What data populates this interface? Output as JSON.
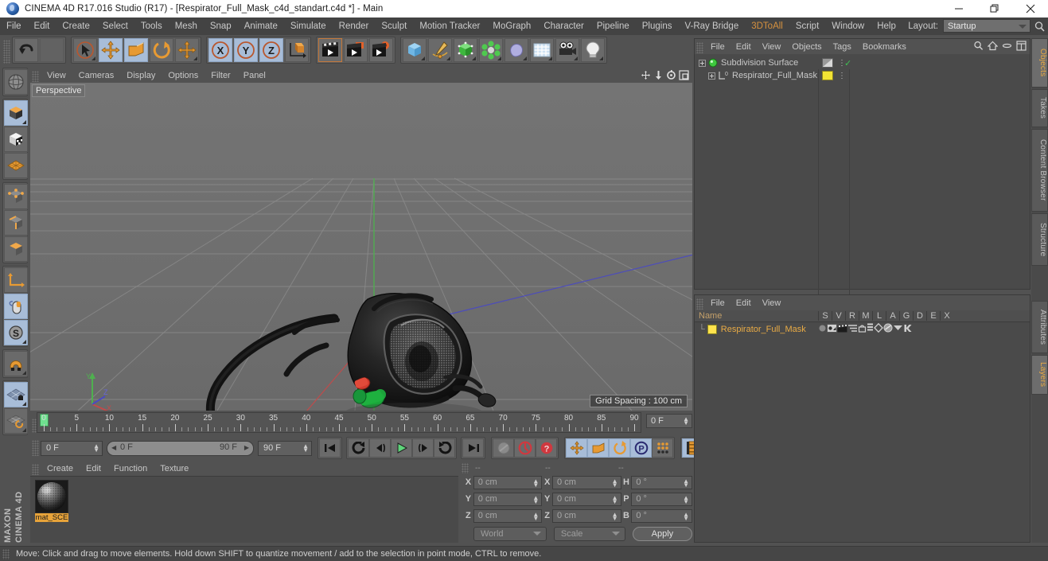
{
  "window": {
    "title": "CINEMA 4D R17.016 Studio (R17) - [Respirator_Full_Mask_c4d_standart.c4d *] - Main",
    "app_icon": "c4d-logo-icon",
    "minimize": "minimize-icon",
    "maximize": "maximize-icon",
    "close": "close-icon"
  },
  "menubar": {
    "items": [
      {
        "label": "File"
      },
      {
        "label": "Edit"
      },
      {
        "label": "Create"
      },
      {
        "label": "Select"
      },
      {
        "label": "Tools"
      },
      {
        "label": "Mesh"
      },
      {
        "label": "Snap"
      },
      {
        "label": "Animate"
      },
      {
        "label": "Simulate"
      },
      {
        "label": "Render"
      },
      {
        "label": "Sculpt"
      },
      {
        "label": "Motion Tracker"
      },
      {
        "label": "MoGraph"
      },
      {
        "label": "Character"
      },
      {
        "label": "Pipeline"
      },
      {
        "label": "Plugins"
      },
      {
        "label": "V-Ray Bridge"
      },
      {
        "label": "3DToAll",
        "accent": true
      },
      {
        "label": "Script"
      },
      {
        "label": "Window"
      },
      {
        "label": "Help"
      }
    ],
    "layout_label": "Layout:",
    "layout_value": "Startup",
    "search_icon": "search-icon"
  },
  "main_toolbar": {
    "groups": [
      {
        "name": "history",
        "buttons": [
          {
            "icon": "undo-icon",
            "state": "enabled"
          },
          {
            "icon": "redo-icon",
            "state": "disabled"
          }
        ]
      },
      {
        "name": "tools",
        "buttons": [
          {
            "icon": "select-live-icon",
            "state": "enabled"
          },
          {
            "icon": "move-tool-icon",
            "state": "active"
          },
          {
            "icon": "scale-tool-icon",
            "state": "enabled"
          },
          {
            "icon": "rotate-tool-icon",
            "state": "enabled"
          },
          {
            "icon": "move-axis-icon",
            "state": "enabled"
          }
        ]
      },
      {
        "name": "axis-locks",
        "buttons": [
          {
            "icon": "axis-x-icon",
            "state": "active"
          },
          {
            "icon": "axis-y-icon",
            "state": "active"
          },
          {
            "icon": "axis-z-icon",
            "state": "active"
          },
          {
            "icon": "world-object-axis-icon",
            "state": "enabled"
          }
        ]
      },
      {
        "name": "render",
        "buttons": [
          {
            "icon": "render-view-icon",
            "state": "enabled"
          },
          {
            "icon": "render-region-icon",
            "state": "enabled"
          },
          {
            "icon": "render-settings-icon",
            "state": "enabled"
          }
        ]
      },
      {
        "name": "objects",
        "buttons": [
          {
            "icon": "cube-primitive-icon",
            "state": "enabled"
          },
          {
            "icon": "spline-pen-icon",
            "state": "enabled"
          },
          {
            "icon": "generator-nurbs-icon",
            "state": "enabled"
          },
          {
            "icon": "mograph-cloner-icon",
            "state": "enabled"
          },
          {
            "icon": "deformer-icon",
            "state": "enabled"
          },
          {
            "icon": "environment-icon",
            "state": "enabled"
          },
          {
            "icon": "camera-icon",
            "state": "enabled"
          },
          {
            "icon": "light-icon",
            "state": "enabled"
          }
        ]
      }
    ]
  },
  "left_toolbar": {
    "buttons": [
      {
        "icon": "texture-axis-icon",
        "state": "enabled"
      },
      {
        "icon": "model-mode-icon",
        "state": "active"
      },
      {
        "icon": "texture-mode-icon",
        "state": "enabled"
      },
      {
        "icon": "polygon-mesh-icon",
        "state": "enabled"
      },
      {
        "icon": "point-mode-icon",
        "state": "enabled"
      },
      {
        "icon": "edge-mode-icon",
        "state": "enabled"
      },
      {
        "icon": "polygon-mode-icon",
        "state": "enabled"
      },
      {
        "icon": "axis-modify-icon",
        "state": "enabled"
      },
      {
        "icon": "viewport-solo-icon",
        "state": "active"
      },
      {
        "icon": "enable-snapping-icon",
        "state": "active"
      },
      {
        "icon": "magnet-icon",
        "state": "enabled"
      },
      {
        "icon": "workplane-lock-icon",
        "state": "active"
      },
      {
        "icon": "workplane-reset-icon",
        "state": "enabled"
      }
    ],
    "brand_line1": "MAXON",
    "brand_line2": "CINEMA 4D"
  },
  "viewport": {
    "menu": [
      {
        "label": "View"
      },
      {
        "label": "Cameras"
      },
      {
        "label": "Display"
      },
      {
        "label": "Options"
      },
      {
        "label": "Filter"
      },
      {
        "label": "Panel"
      }
    ],
    "corner_icons": [
      "pan-view-icon",
      "dolly-view-icon",
      "rotate-view-icon",
      "maximize-view-icon"
    ],
    "label": "Perspective",
    "grid_spacing": "Grid Spacing : 100 cm",
    "axis_gizmo": {
      "x": "X",
      "y": "Y",
      "z": "Z"
    },
    "object_name": "Respirator_Full_Mask"
  },
  "timeline": {
    "ticks": [
      0,
      5,
      10,
      15,
      20,
      25,
      30,
      35,
      40,
      45,
      50,
      55,
      60,
      65,
      70,
      75,
      80,
      85,
      90
    ],
    "current_frame_field": "0 F",
    "playhead_frame": 0
  },
  "animbar": {
    "current_frame": "0 F",
    "range_start": "0 F",
    "range_end": "90 F",
    "end_frame": "90 F",
    "transport": [
      {
        "icon": "go-to-start-icon"
      },
      {
        "icon": "play-reverse-icon"
      },
      {
        "icon": "previous-frame-icon"
      },
      {
        "icon": "play-forward-icon",
        "state": "active-green"
      },
      {
        "icon": "next-frame-icon"
      },
      {
        "icon": "play-loop-icon"
      },
      {
        "icon": "go-to-end-icon"
      }
    ],
    "record_group": [
      {
        "icon": "autokey-icon",
        "state": "disabled"
      },
      {
        "icon": "record-active-objects-icon",
        "state": "red"
      },
      {
        "icon": "keyframe-selection-icon",
        "state": "red"
      }
    ],
    "key_group": [
      {
        "icon": "record-position-icon",
        "state": "active"
      },
      {
        "icon": "record-scale-icon",
        "state": "active"
      },
      {
        "icon": "record-rotation-icon",
        "state": "active"
      },
      {
        "icon": "record-parameter-icon",
        "state": "active"
      },
      {
        "icon": "record-pla-icon",
        "state": "enabled"
      }
    ],
    "extra": [
      {
        "icon": "timeline-settings-icon",
        "state": "active"
      }
    ]
  },
  "material_manager": {
    "menu": [
      {
        "label": "Create"
      },
      {
        "label": "Edit"
      },
      {
        "label": "Function"
      },
      {
        "label": "Texture"
      }
    ],
    "materials": [
      {
        "name": "mat_SCE",
        "preview": "material-sphere-preview",
        "selected": true
      }
    ]
  },
  "coordinates": {
    "headers": [
      "--",
      "--",
      "--"
    ],
    "rows": [
      {
        "pos_label": "X",
        "pos_value": "0 cm",
        "size_label": "X",
        "size_value": "0 cm",
        "rot_label": "H",
        "rot_value": "0 °"
      },
      {
        "pos_label": "Y",
        "pos_value": "0 cm",
        "size_label": "Y",
        "size_value": "0 cm",
        "rot_label": "P",
        "rot_value": "0 °"
      },
      {
        "pos_label": "Z",
        "pos_value": "0 cm",
        "size_label": "Z",
        "size_value": "0 cm",
        "rot_label": "B",
        "rot_value": "0 °"
      }
    ],
    "system": "World",
    "mode": "Scale",
    "apply": "Apply"
  },
  "object_manager": {
    "menu": [
      {
        "label": "File"
      },
      {
        "label": "Edit"
      },
      {
        "label": "View"
      },
      {
        "label": "Objects"
      },
      {
        "label": "Tags"
      },
      {
        "label": "Bookmarks"
      }
    ],
    "icons": [
      "search-icon",
      "home-icon",
      "minus-icon",
      "fit-icon"
    ],
    "rows": [
      {
        "name": "Subdivision Surface",
        "icon": "subdivision-surface-icon",
        "indent": 0,
        "tag": "checker-tag",
        "visible_check": "✓"
      },
      {
        "name": "Respirator_Full_Mask",
        "icon": "null-object-icon",
        "indent": 1,
        "tag": "yellow-material-tag"
      }
    ]
  },
  "layer_manager": {
    "menu": [
      {
        "label": "File"
      },
      {
        "label": "Edit"
      },
      {
        "label": "View"
      }
    ],
    "columns": [
      "Name",
      "S",
      "V",
      "R",
      "M",
      "L",
      "A",
      "G",
      "D",
      "E",
      "X"
    ],
    "rows": [
      {
        "name": "Respirator_Full_Mask",
        "color": "#ffe34d",
        "cells": [
          "solo-dot-icon",
          "view-icon",
          "render-icon",
          "manager-icon",
          "lock-icon",
          "animation-icon",
          "generator-icon",
          "deformer-icon",
          "expression-icon",
          "xref-icon"
        ]
      }
    ]
  },
  "right_tabs": {
    "top": [
      {
        "label": "Objects",
        "selected": true
      },
      {
        "label": "Takes",
        "selected": false
      },
      {
        "label": "Content Browser",
        "selected": false
      },
      {
        "label": "Structure",
        "selected": false
      }
    ],
    "bottom": [
      {
        "label": "Attributes",
        "selected": false
      },
      {
        "label": "Layers",
        "selected": true
      }
    ]
  },
  "statusbar": {
    "message": "Move: Click and drag to move elements. Hold down SHIFT to quantize movement / add to the selection in point mode, CTRL to remove."
  },
  "colors": {
    "accent_orange": "#e9ab45",
    "active_blue": "#a8bdd8",
    "panel_bg": "#4a4a4a",
    "chrome_bg": "#525252",
    "viewport_bg": "#6e6e6e",
    "axis_x": "#c24a4a",
    "axis_y": "#4fb04f",
    "axis_z": "#4a4ac2",
    "material_label": "#e7a33a",
    "play_green": "#5ed47a"
  }
}
